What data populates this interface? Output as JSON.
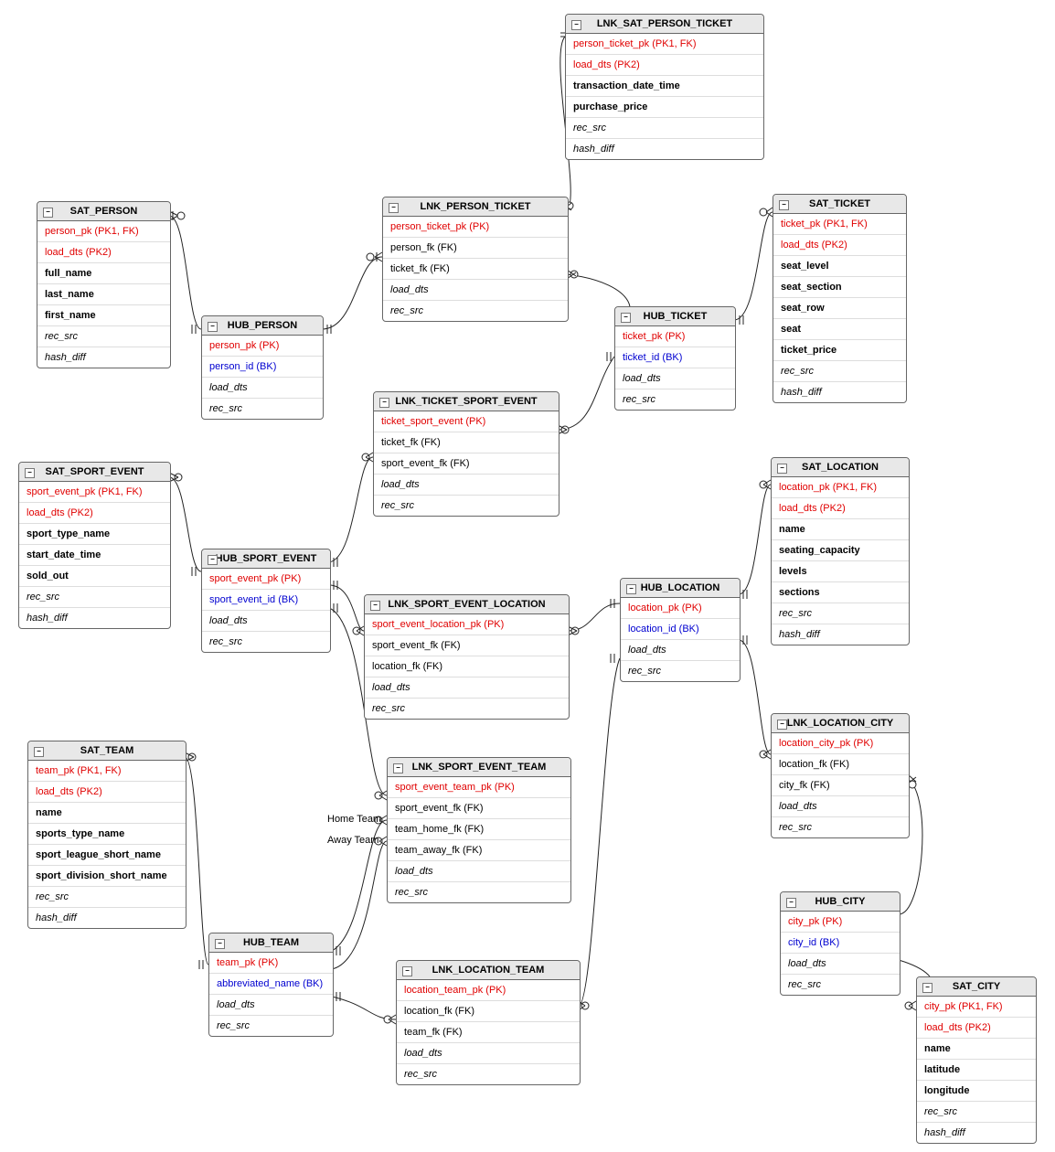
{
  "relationshipLabels": {
    "homeTeam": "Home Team",
    "awayTeam": "Away Team"
  },
  "entities": {
    "sat_person": {
      "title": "SAT_PERSON",
      "rows": [
        {
          "t": "person_pk (PK1, FK)",
          "c": "pk"
        },
        {
          "t": "load_dts (PK2)",
          "c": "pk"
        },
        {
          "t": "full_name",
          "c": "bold"
        },
        {
          "t": "last_name",
          "c": "bold"
        },
        {
          "t": "first_name",
          "c": "bold"
        },
        {
          "t": "rec_src",
          "c": "ital"
        },
        {
          "t": "hash_diff",
          "c": "ital"
        }
      ]
    },
    "hub_person": {
      "title": "HUB_PERSON",
      "rows": [
        {
          "t": "person_pk (PK)",
          "c": "pk"
        },
        {
          "t": "person_id (BK)",
          "c": "bk"
        },
        {
          "t": "load_dts",
          "c": "ital"
        },
        {
          "t": "rec_src",
          "c": "ital"
        }
      ]
    },
    "sat_sport_event": {
      "title": "SAT_SPORT_EVENT",
      "rows": [
        {
          "t": "sport_event_pk (PK1, FK)",
          "c": "pk"
        },
        {
          "t": "load_dts (PK2)",
          "c": "pk"
        },
        {
          "t": "sport_type_name",
          "c": "bold"
        },
        {
          "t": "start_date_time",
          "c": "bold"
        },
        {
          "t": "sold_out",
          "c": "bold"
        },
        {
          "t": "rec_src",
          "c": "ital"
        },
        {
          "t": "hash_diff",
          "c": "ital"
        }
      ]
    },
    "hub_sport_event": {
      "title": "HUB_SPORT_EVENT",
      "rows": [
        {
          "t": "sport_event_pk (PK)",
          "c": "pk"
        },
        {
          "t": "sport_event_id (BK)",
          "c": "bk"
        },
        {
          "t": "load_dts",
          "c": "ital"
        },
        {
          "t": "rec_src",
          "c": "ital"
        }
      ]
    },
    "sat_team": {
      "title": "SAT_TEAM",
      "rows": [
        {
          "t": "team_pk (PK1, FK)",
          "c": "pk"
        },
        {
          "t": "load_dts (PK2)",
          "c": "pk"
        },
        {
          "t": "name",
          "c": "bold"
        },
        {
          "t": "sports_type_name",
          "c": "bold"
        },
        {
          "t": "sport_league_short_name",
          "c": "bold"
        },
        {
          "t": "sport_division_short_name",
          "c": "bold"
        },
        {
          "t": "rec_src",
          "c": "ital"
        },
        {
          "t": "hash_diff",
          "c": "ital"
        }
      ]
    },
    "hub_team": {
      "title": "HUB_TEAM",
      "rows": [
        {
          "t": "team_pk (PK)",
          "c": "pk"
        },
        {
          "t": "abbreviated_name (BK)",
          "c": "bk"
        },
        {
          "t": "load_dts",
          "c": "ital"
        },
        {
          "t": "rec_src",
          "c": "ital"
        }
      ]
    },
    "lnk_person_ticket": {
      "title": "LNK_PERSON_TICKET",
      "rows": [
        {
          "t": "person_ticket_pk (PK)",
          "c": "pk"
        },
        {
          "t": "person_fk (FK)",
          "c": ""
        },
        {
          "t": "ticket_fk (FK)",
          "c": ""
        },
        {
          "t": "load_dts",
          "c": "ital"
        },
        {
          "t": "rec_src",
          "c": "ital"
        }
      ]
    },
    "lnk_sat_person_ticket": {
      "title": "LNK_SAT_PERSON_TICKET",
      "rows": [
        {
          "t": "person_ticket_pk (PK1, FK)",
          "c": "pk"
        },
        {
          "t": "load_dts (PK2)",
          "c": "pk"
        },
        {
          "t": "transaction_date_time",
          "c": "bold"
        },
        {
          "t": "purchase_price",
          "c": "bold"
        },
        {
          "t": "rec_src",
          "c": "ital"
        },
        {
          "t": "hash_diff",
          "c": "ital"
        }
      ]
    },
    "lnk_ticket_sport_event": {
      "title": "LNK_TICKET_SPORT_EVENT",
      "rows": [
        {
          "t": "ticket_sport_event (PK)",
          "c": "pk"
        },
        {
          "t": "ticket_fk (FK)",
          "c": ""
        },
        {
          "t": "sport_event_fk (FK)",
          "c": ""
        },
        {
          "t": "load_dts",
          "c": "ital"
        },
        {
          "t": "rec_src",
          "c": "ital"
        }
      ]
    },
    "lnk_sport_event_location": {
      "title": "LNK_SPORT_EVENT_LOCATION",
      "rows": [
        {
          "t": "sport_event_location_pk (PK)",
          "c": "pk"
        },
        {
          "t": "sport_event_fk (FK)",
          "c": ""
        },
        {
          "t": "location_fk (FK)",
          "c": ""
        },
        {
          "t": "load_dts",
          "c": "ital"
        },
        {
          "t": "rec_src",
          "c": "ital"
        }
      ]
    },
    "lnk_sport_event_team": {
      "title": "LNK_SPORT_EVENT_TEAM",
      "rows": [
        {
          "t": "sport_event_team_pk (PK)",
          "c": "pk"
        },
        {
          "t": "sport_event_fk (FK)",
          "c": ""
        },
        {
          "t": "team_home_fk (FK)",
          "c": ""
        },
        {
          "t": "team_away_fk (FK)",
          "c": ""
        },
        {
          "t": "load_dts",
          "c": "ital"
        },
        {
          "t": "rec_src",
          "c": "ital"
        }
      ]
    },
    "lnk_location_team": {
      "title": "LNK_LOCATION_TEAM",
      "rows": [
        {
          "t": "location_team_pk (PK)",
          "c": "pk"
        },
        {
          "t": "location_fk (FK)",
          "c": ""
        },
        {
          "t": "team_fk (FK)",
          "c": ""
        },
        {
          "t": "load_dts",
          "c": "ital"
        },
        {
          "t": "rec_src",
          "c": "ital"
        }
      ]
    },
    "hub_ticket": {
      "title": "HUB_TICKET",
      "rows": [
        {
          "t": "ticket_pk (PK)",
          "c": "pk"
        },
        {
          "t": "ticket_id (BK)",
          "c": "bk"
        },
        {
          "t": "load_dts",
          "c": "ital"
        },
        {
          "t": "rec_src",
          "c": "ital"
        }
      ]
    },
    "sat_ticket": {
      "title": "SAT_TICKET",
      "rows": [
        {
          "t": "ticket_pk (PK1, FK)",
          "c": "pk"
        },
        {
          "t": "load_dts (PK2)",
          "c": "pk"
        },
        {
          "t": "seat_level",
          "c": "bold"
        },
        {
          "t": "seat_section",
          "c": "bold"
        },
        {
          "t": "seat_row",
          "c": "bold"
        },
        {
          "t": "seat",
          "c": "bold"
        },
        {
          "t": "ticket_price",
          "c": "bold"
        },
        {
          "t": "rec_src",
          "c": "ital"
        },
        {
          "t": "hash_diff",
          "c": "ital"
        }
      ]
    },
    "hub_location": {
      "title": "HUB_LOCATION",
      "rows": [
        {
          "t": "location_pk (PK)",
          "c": "pk"
        },
        {
          "t": "location_id (BK)",
          "c": "bk"
        },
        {
          "t": "load_dts",
          "c": "ital"
        },
        {
          "t": "rec_src",
          "c": "ital"
        }
      ]
    },
    "sat_location": {
      "title": "SAT_LOCATION",
      "rows": [
        {
          "t": "location_pk (PK1, FK)",
          "c": "pk"
        },
        {
          "t": "load_dts (PK2)",
          "c": "pk"
        },
        {
          "t": "name",
          "c": "bold"
        },
        {
          "t": "seating_capacity",
          "c": "bold"
        },
        {
          "t": "levels",
          "c": "bold"
        },
        {
          "t": "sections",
          "c": "bold"
        },
        {
          "t": "rec_src",
          "c": "ital"
        },
        {
          "t": "hash_diff",
          "c": "ital"
        }
      ]
    },
    "lnk_location_city": {
      "title": "LNK_LOCATION_CITY",
      "rows": [
        {
          "t": "location_city_pk (PK)",
          "c": "pk"
        },
        {
          "t": "location_fk (FK)",
          "c": ""
        },
        {
          "t": "city_fk (FK)",
          "c": ""
        },
        {
          "t": "load_dts",
          "c": "ital"
        },
        {
          "t": "rec_src",
          "c": "ital"
        }
      ]
    },
    "hub_city": {
      "title": "HUB_CITY",
      "rows": [
        {
          "t": "city_pk (PK)",
          "c": "pk"
        },
        {
          "t": "city_id (BK)",
          "c": "bk"
        },
        {
          "t": "load_dts",
          "c": "ital"
        },
        {
          "t": "rec_src",
          "c": "ital"
        }
      ]
    },
    "sat_city": {
      "title": "SAT_CITY",
      "rows": [
        {
          "t": "city_pk (PK1, FK)",
          "c": "pk"
        },
        {
          "t": "load_dts (PK2)",
          "c": "pk"
        },
        {
          "t": "name",
          "c": "bold"
        },
        {
          "t": "latitude",
          "c": "bold"
        },
        {
          "t": "longitude",
          "c": "bold"
        },
        {
          "t": "rec_src",
          "c": "ital"
        },
        {
          "t": "hash_diff",
          "c": "ital"
        }
      ]
    }
  }
}
